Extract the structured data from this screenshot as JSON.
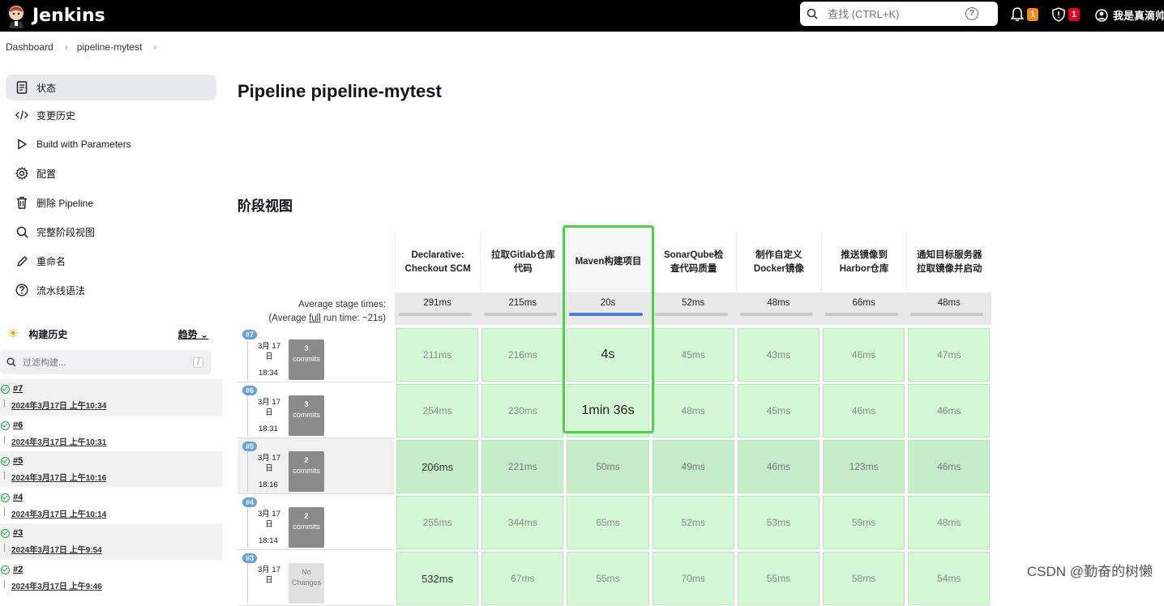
{
  "header": {
    "app_name": "Jenkins",
    "search_placeholder": "查找 (CTRL+K)",
    "help_icon": "?",
    "notifications_count": "1",
    "security_count": "1",
    "user_name": "我是真滴帅"
  },
  "breadcrumb": [
    "Dashboard",
    "pipeline-mytest"
  ],
  "sidebar": {
    "items": [
      {
        "label": "状态",
        "icon": "document-icon"
      },
      {
        "label": "变更历史",
        "icon": "code-icon"
      },
      {
        "label": "Build with Parameters",
        "icon": "play-icon"
      },
      {
        "label": "配置",
        "icon": "gear-icon"
      },
      {
        "label": "删除 Pipeline",
        "icon": "trash-icon"
      },
      {
        "label": "完整阶段视图",
        "icon": "search-icon"
      },
      {
        "label": "重命名",
        "icon": "pencil-icon"
      },
      {
        "label": "流水线语法",
        "icon": "help-icon"
      }
    ]
  },
  "build_history": {
    "title": "构建历史",
    "trend": "趋势",
    "filter_placeholder": "过滤构建...",
    "filter_shortcut": "/",
    "builds": [
      {
        "num": "#7",
        "date": "2024年3月17日 上午10:34"
      },
      {
        "num": "#6",
        "date": "2024年3月17日 上午10:31"
      },
      {
        "num": "#5",
        "date": "2024年3月17日 上午10:16"
      },
      {
        "num": "#4",
        "date": "2024年3月17日 上午10:14"
      },
      {
        "num": "#3",
        "date": "2024年3月17日 上午9:54"
      },
      {
        "num": "#2",
        "date": "2024年3月17日 上午9:46"
      }
    ]
  },
  "main": {
    "title": "Pipeline pipeline-mytest",
    "stage_view_title": "阶段视图",
    "avg_label_1": "Average stage times:",
    "avg_label_2a": "(Average ",
    "avg_label_full": "full",
    "avg_label_2b": " run time: ~21s)",
    "stages": [
      {
        "name": "Declarative: Checkout SCM",
        "avg": "291ms",
        "fill": 0
      },
      {
        "name": "拉取Gitlab仓库代码",
        "avg": "215ms",
        "fill": 0
      },
      {
        "name": "Maven构建项目",
        "avg": "20s",
        "fill": 1
      },
      {
        "name": "SonarQube检查代码质量",
        "avg": "52ms",
        "fill": 0
      },
      {
        "name": "制作自定义Docker镜像",
        "avg": "48ms",
        "fill": 0
      },
      {
        "name": "推送镜像到Harbor仓库",
        "avg": "66ms",
        "fill": 0
      },
      {
        "name": "通知目标服务器拉取镜像并启动",
        "avg": "48ms",
        "fill": 0
      }
    ],
    "runs": [
      {
        "badge": "#7",
        "date": "3月 17 日",
        "time": "18:34",
        "commits_count": "3",
        "commits_word": "commits",
        "cells": [
          "211ms",
          "216ms",
          "4s",
          "45ms",
          "43ms",
          "46ms",
          "47ms"
        ]
      },
      {
        "badge": "#6",
        "date": "3月 17 日",
        "time": "18:31",
        "commits_count": "3",
        "commits_word": "commits",
        "cells": [
          "254ms",
          "230ms",
          "1min 36s",
          "48ms",
          "45ms",
          "46ms",
          "46ms"
        ]
      },
      {
        "badge": "#5",
        "date": "3月 17 日",
        "time": "18:16",
        "commits_count": "2",
        "commits_word": "commits",
        "cells": [
          "206ms",
          "221ms",
          "50ms",
          "49ms",
          "46ms",
          "123ms",
          "46ms"
        ]
      },
      {
        "badge": "#4",
        "date": "3月 17 日",
        "time": "18:14",
        "commits_count": "2",
        "commits_word": "commits",
        "cells": [
          "255ms",
          "344ms",
          "65ms",
          "52ms",
          "53ms",
          "59ms",
          "48ms"
        ]
      },
      {
        "badge": "#3",
        "date": "3月 17 日",
        "time": "",
        "commits_count": "No",
        "commits_word": "Changes",
        "cells": [
          "532ms",
          "67ms",
          "55ms",
          "70ms",
          "55ms",
          "58ms",
          "54ms"
        ]
      }
    ]
  },
  "watermark": "CSDN @勤奋的树懒"
}
